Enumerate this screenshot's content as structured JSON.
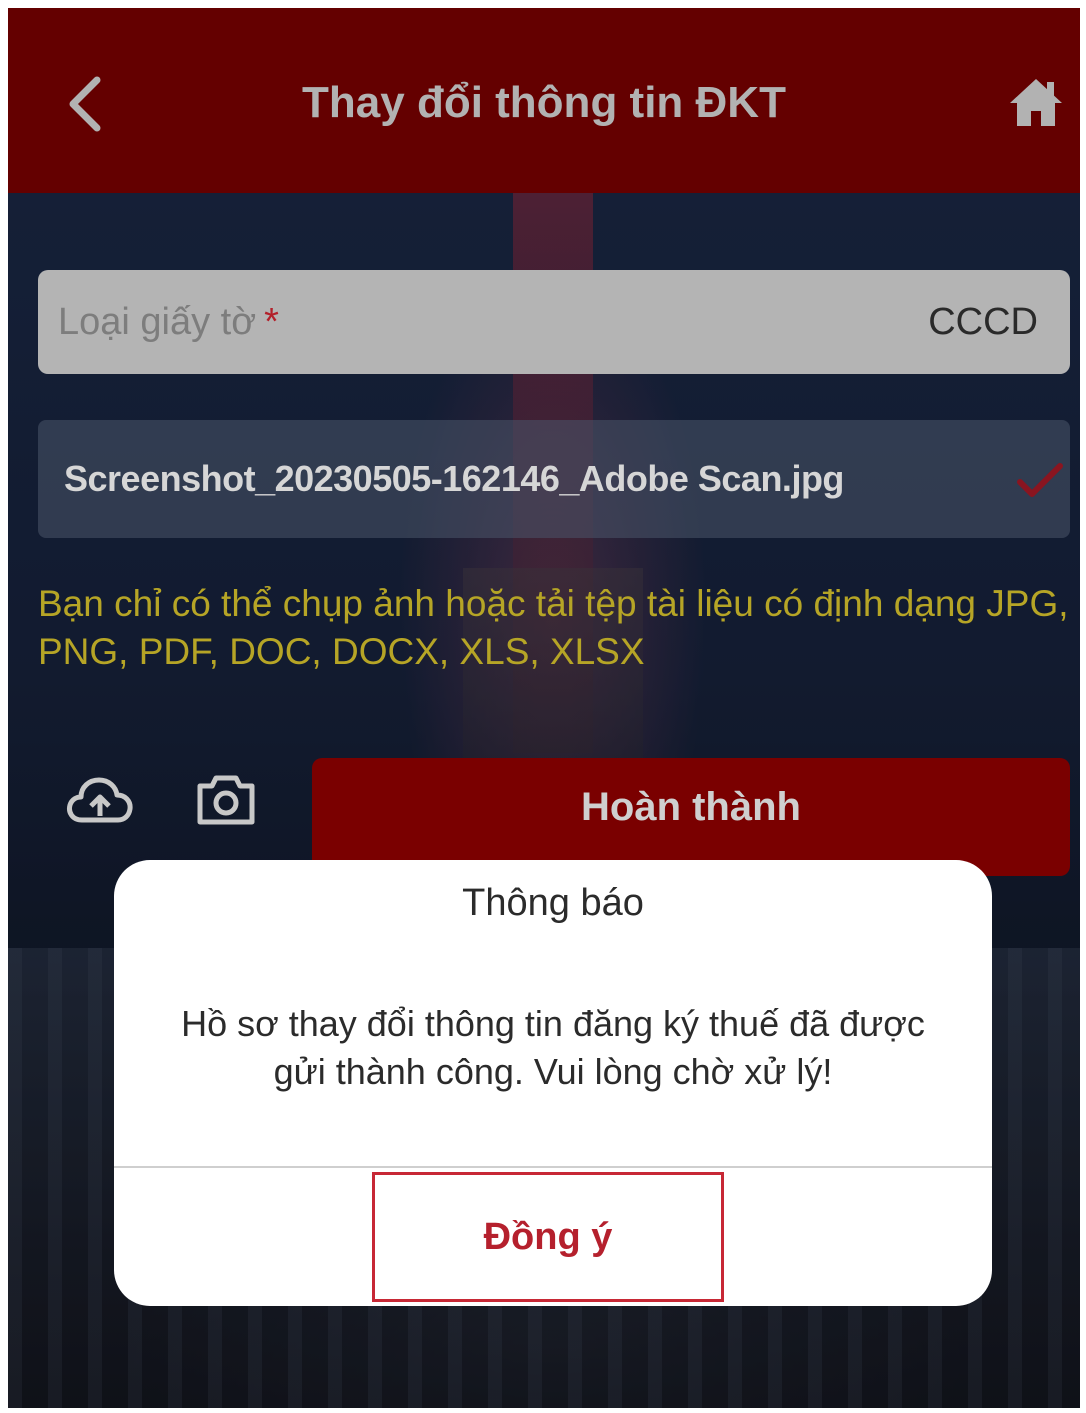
{
  "header": {
    "title": "Thay đổi thông tin ĐKT",
    "back_icon": "chevron-left-icon",
    "home_icon": "home-icon",
    "background_color": "#7a0000"
  },
  "form": {
    "doc_type_label": "Loại giấy tờ",
    "required_mark": "*",
    "doc_type_value": "CCCD",
    "file_name": "Screenshot_20230505-162146_Adobe Scan.jpg",
    "file_status_icon": "checkmark-icon",
    "note": "Bạn chỉ có thể chụp ảnh hoặc tải tệp tài liệu có định dạng JPG, PNG, PDF, DOC, DOCX, XLS, XLSX",
    "upload_icon": "cloud-upload-icon",
    "camera_icon": "camera-icon",
    "submit_label": "Hoàn thành"
  },
  "dialog": {
    "title": "Thông báo",
    "message": "Hồ sơ thay đổi thông tin đăng ký thuế đã được gửi thành công. Vui lòng chờ xử lý!",
    "confirm_label": "Đồng ý"
  },
  "colors": {
    "accent": "#7a0000",
    "note_text": "#b6a526",
    "dialog_button_text": "#b5202d"
  }
}
